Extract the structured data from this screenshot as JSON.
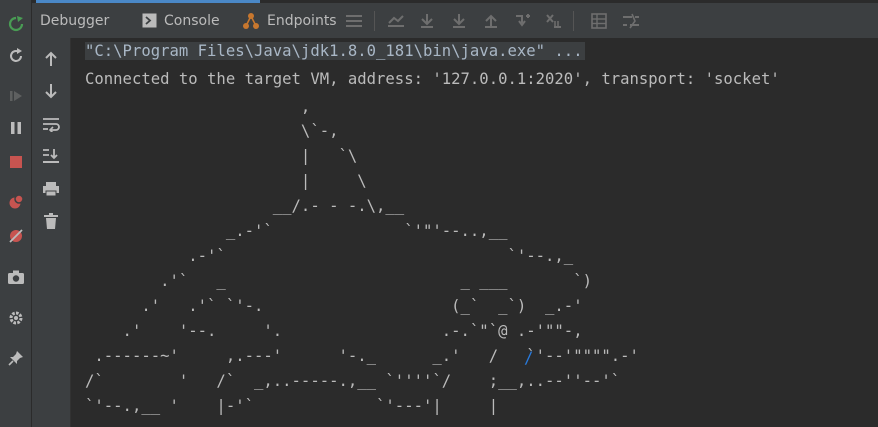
{
  "tabs": [
    {
      "label": "Debugger",
      "icon": ""
    },
    {
      "label": "Console",
      "icon": "console-icon"
    },
    {
      "label": "Endpoints",
      "icon": "endpoints-icon"
    }
  ],
  "toolbar_icons": [
    "menu-icon",
    "show-execution-point-icon",
    "step-over-icon",
    "step-into-icon",
    "step-out-icon",
    "run-to-cursor-icon",
    "evaluate-expression-icon",
    "table-icon",
    "settings-list-icon"
  ],
  "left_toolbar_icons": [
    "rerun-icon",
    "refresh-icon",
    "resume-icon",
    "pause-icon",
    "stop-icon",
    "view-breakpoints-icon",
    "mute-breakpoints-icon",
    "camera-icon",
    "settings-icon",
    "pin-icon"
  ],
  "console_toolbar_icons": [
    "up-arrow-icon",
    "down-arrow-icon",
    "soft-wrap-icon",
    "scroll-to-end-icon",
    "print-icon",
    "trash-icon"
  ],
  "colors": {
    "accent": "#4a88c7",
    "rerun": "#499c54",
    "stop": "#c75450",
    "breakpoint": "#c75450"
  },
  "console": {
    "command": "\"C:\\Program Files\\Java\\jdk1.8.0_181\\bin\\java.exe\" ...",
    "connected": "Connected to the target VM, address: '127.0.0.1:2020', transport: 'socket'",
    "art": [
      "                       ,",
      "                       \\`-,",
      "                       |   `\\",
      "                       |     \\",
      "                    __/.- - -.\\,__",
      "               _.-'`              `'\"'--..,__",
      "           .-'`                              `'--.,_",
      "        .'`   _                         _ ___       `)",
      "      .'   .'` `'-.                    (_`  _`)  _.-'",
      "    .'    '--.     '.                 .-.`\"`@ .-'\"\"-,",
      " .------~'     ,.---'      '-._      _.'   /   `'--'\"\"\"\".-'",
      "/`        '   /`  _,..-----.,__ `''''`/    ;__,..--''--'`",
      "`'--.,__ '    |-'`             `'---'|     |"
    ],
    "slash": "/"
  }
}
